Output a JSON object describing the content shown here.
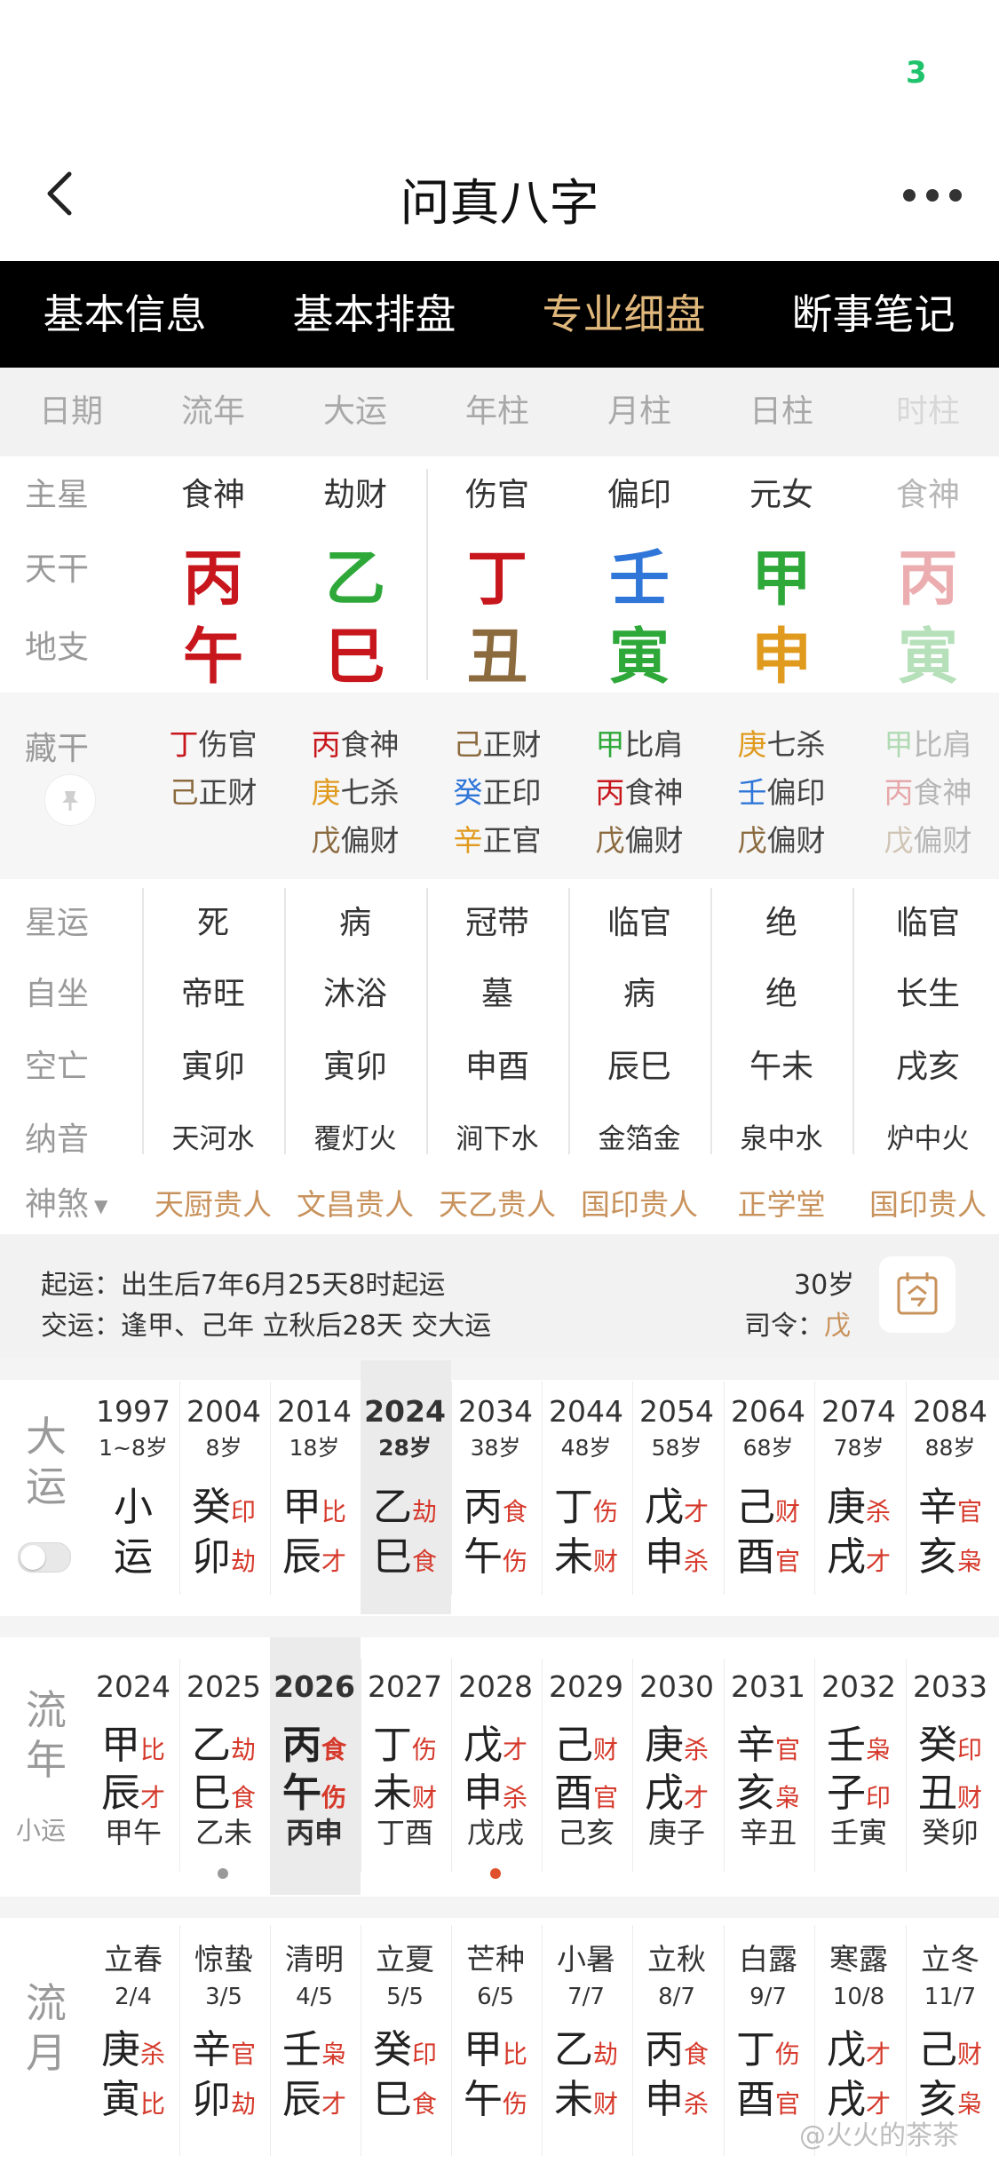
{
  "status": {
    "indicator": "3"
  },
  "nav": {
    "title": "问真八字"
  },
  "tabs": [
    "基本信息",
    "基本排盘",
    "专业细盘",
    "断事笔记"
  ],
  "header": [
    "日期",
    "流年",
    "大运",
    "年柱",
    "月柱",
    "日柱",
    "时柱"
  ],
  "row_labels": {
    "zhuxing": "主星",
    "tiangan": "天干",
    "dizhi": "地支",
    "canggan": "藏干",
    "xingyun": "星运",
    "zizuo": "自坐",
    "kongwang": "空亡",
    "nayin": "纳音",
    "shensha": "神煞"
  },
  "main_stars": [
    "食神",
    "劫财",
    "伤官",
    "偏印",
    "元女",
    "食神"
  ],
  "tiangan": [
    {
      "char": "丙",
      "color": "#c8161d"
    },
    {
      "char": "乙",
      "color": "#2fa83a"
    },
    {
      "char": "丁",
      "color": "#c8161d"
    },
    {
      "char": "壬",
      "color": "#2f76d8"
    },
    {
      "char": "甲",
      "color": "#2fa83a"
    },
    {
      "char": "丙",
      "color": "#c8161d"
    }
  ],
  "dizhi": [
    {
      "char": "午",
      "color": "#c8161d"
    },
    {
      "char": "巳",
      "color": "#c8161d"
    },
    {
      "char": "丑",
      "color": "#8b6a3e"
    },
    {
      "char": "寅",
      "color": "#2fa83a"
    },
    {
      "char": "申",
      "color": "#e09a1e"
    },
    {
      "char": "寅",
      "color": "#2fa83a"
    }
  ],
  "canggan": [
    [
      {
        "c": "丁",
        "col": "#c8161d",
        "g": "伤官"
      },
      {
        "c": "己",
        "col": "#8b6a3e",
        "g": "正财"
      }
    ],
    [
      {
        "c": "丙",
        "col": "#c8161d",
        "g": "食神"
      },
      {
        "c": "庚",
        "col": "#e09a1e",
        "g": "七杀"
      },
      {
        "c": "戊",
        "col": "#8b6a3e",
        "g": "偏财"
      }
    ],
    [
      {
        "c": "己",
        "col": "#8b6a3e",
        "g": "正财"
      },
      {
        "c": "癸",
        "col": "#2f76d8",
        "g": "正印"
      },
      {
        "c": "辛",
        "col": "#e09a1e",
        "g": "正官"
      }
    ],
    [
      {
        "c": "甲",
        "col": "#2fa83a",
        "g": "比肩"
      },
      {
        "c": "丙",
        "col": "#c8161d",
        "g": "食神"
      },
      {
        "c": "戊",
        "col": "#8b6a3e",
        "g": "偏财"
      }
    ],
    [
      {
        "c": "庚",
        "col": "#e09a1e",
        "g": "七杀"
      },
      {
        "c": "壬",
        "col": "#2f76d8",
        "g": "偏印"
      },
      {
        "c": "戊",
        "col": "#8b6a3e",
        "g": "偏财"
      }
    ],
    [
      {
        "c": "甲",
        "col": "#2fa83a",
        "g": "比肩"
      },
      {
        "c": "丙",
        "col": "#c8161d",
        "g": "食神"
      },
      {
        "c": "戊",
        "col": "#8b6a3e",
        "g": "偏财"
      }
    ]
  ],
  "xingyun": [
    "死",
    "病",
    "冠带",
    "临官",
    "绝",
    "临官"
  ],
  "zizuo": [
    "帝旺",
    "沐浴",
    "墓",
    "病",
    "绝",
    "长生"
  ],
  "kongwang": [
    "寅卯",
    "寅卯",
    "申酉",
    "辰巳",
    "午未",
    "戌亥"
  ],
  "nayin": [
    "天河水",
    "覆灯火",
    "涧下水",
    "金箔金",
    "泉中水",
    "炉中火"
  ],
  "shensha": [
    "天厨贵人",
    "文昌贵人",
    "天乙贵人",
    "国印贵人",
    "正学堂",
    "国印贵人"
  ],
  "info": {
    "qiyun": "起运：出生后7年6月25天8时起运",
    "jiaoyun": "交运：逢甲、己年 立秋后28天 交大运",
    "age": "30岁",
    "siling_label": "司令：",
    "siling_value": "戊"
  },
  "dayun": {
    "title": [
      "大",
      "运"
    ],
    "items": [
      {
        "year": "1997",
        "age": "1~8岁",
        "gan": "小",
        "gs": "",
        "zhi": "运",
        "zs": ""
      },
      {
        "year": "2004",
        "age": "8岁",
        "gan": "癸",
        "gs": "印",
        "zhi": "卯",
        "zs": "劫"
      },
      {
        "year": "2014",
        "age": "18岁",
        "gan": "甲",
        "gs": "比",
        "zhi": "辰",
        "zs": "才"
      },
      {
        "year": "2024",
        "age": "28岁",
        "gan": "乙",
        "gs": "劫",
        "zhi": "巳",
        "zs": "食"
      },
      {
        "year": "2034",
        "age": "38岁",
        "gan": "丙",
        "gs": "食",
        "zhi": "午",
        "zs": "伤"
      },
      {
        "year": "2044",
        "age": "48岁",
        "gan": "丁",
        "gs": "伤",
        "zhi": "未",
        "zs": "财"
      },
      {
        "year": "2054",
        "age": "58岁",
        "gan": "戊",
        "gs": "才",
        "zhi": "申",
        "zs": "杀"
      },
      {
        "year": "2064",
        "age": "68岁",
        "gan": "己",
        "gs": "财",
        "zhi": "酉",
        "zs": "官"
      },
      {
        "year": "2074",
        "age": "78岁",
        "gan": "庚",
        "gs": "杀",
        "zhi": "戌",
        "zs": "才"
      },
      {
        "year": "2084",
        "age": "88岁",
        "gan": "辛",
        "gs": "官",
        "zhi": "亥",
        "zs": "枭"
      }
    ]
  },
  "liunian": {
    "title": [
      "流",
      "年"
    ],
    "subtitle": "小运",
    "items": [
      {
        "year": "2024",
        "gan": "甲",
        "gs": "比",
        "zhi": "辰",
        "zs": "才",
        "xy": "甲午"
      },
      {
        "year": "2025",
        "gan": "乙",
        "gs": "劫",
        "zhi": "巳",
        "zs": "食",
        "xy": "乙未"
      },
      {
        "year": "2026",
        "gan": "丙",
        "gs": "食",
        "zhi": "午",
        "zs": "伤",
        "xy": "丙申"
      },
      {
        "year": "2027",
        "gan": "丁",
        "gs": "伤",
        "zhi": "未",
        "zs": "财",
        "xy": "丁酉"
      },
      {
        "year": "2028",
        "gan": "戊",
        "gs": "才",
        "zhi": "申",
        "zs": "杀",
        "xy": "戊戌"
      },
      {
        "year": "2029",
        "gan": "己",
        "gs": "财",
        "zhi": "酉",
        "zs": "官",
        "xy": "己亥"
      },
      {
        "year": "2030",
        "gan": "庚",
        "gs": "杀",
        "zhi": "戌",
        "zs": "才",
        "xy": "庚子"
      },
      {
        "year": "2031",
        "gan": "辛",
        "gs": "官",
        "zhi": "亥",
        "zs": "枭",
        "xy": "辛丑"
      },
      {
        "year": "2032",
        "gan": "壬",
        "gs": "枭",
        "zhi": "子",
        "zs": "印",
        "xy": "壬寅"
      },
      {
        "year": "2033",
        "gan": "癸",
        "gs": "印",
        "zhi": "丑",
        "zs": "财",
        "xy": "癸卯"
      }
    ]
  },
  "liuyue": {
    "title": [
      "流",
      "月"
    ],
    "items": [
      {
        "term": "立春",
        "date": "2/4",
        "gan": "庚",
        "gs": "杀",
        "zhi": "寅",
        "zs": "比"
      },
      {
        "term": "惊蛰",
        "date": "3/5",
        "gan": "辛",
        "gs": "官",
        "zhi": "卯",
        "zs": "劫"
      },
      {
        "term": "清明",
        "date": "4/5",
        "gan": "壬",
        "gs": "枭",
        "zhi": "辰",
        "zs": "才"
      },
      {
        "term": "立夏",
        "date": "5/5",
        "gan": "癸",
        "gs": "印",
        "zhi": "巳",
        "zs": "食"
      },
      {
        "term": "芒种",
        "date": "6/5",
        "gan": "甲",
        "gs": "比",
        "zhi": "午",
        "zs": "伤"
      },
      {
        "term": "小暑",
        "date": "7/7",
        "gan": "乙",
        "gs": "劫",
        "zhi": "未",
        "zs": "财"
      },
      {
        "term": "立秋",
        "date": "8/7",
        "gan": "丙",
        "gs": "食",
        "zhi": "申",
        "zs": "杀"
      },
      {
        "term": "白露",
        "date": "9/7",
        "gan": "丁",
        "gs": "伤",
        "zhi": "酉",
        "zs": "官"
      },
      {
        "term": "寒露",
        "date": "10/8",
        "gan": "戊",
        "gs": "才",
        "zhi": "戌",
        "zs": "才"
      },
      {
        "term": "立冬",
        "date": "11/7",
        "gan": "己",
        "gs": "财",
        "zhi": "亥",
        "zs": "枭"
      }
    ]
  },
  "watermark": "@火火的茶茶"
}
